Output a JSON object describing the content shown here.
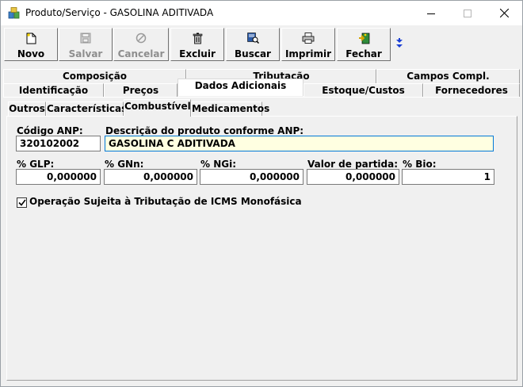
{
  "window": {
    "title": "Produto/Serviço - GASOLINA ADITIVADA",
    "icon": "app-products-icon",
    "controls": {
      "minimize": "minimize-icon",
      "maximize": "maximize-icon",
      "close": "close-icon"
    }
  },
  "toolbar": {
    "novo": "Novo",
    "salvar": "Salvar",
    "cancelar": "Cancelar",
    "excluir": "Excluir",
    "buscar": "Buscar",
    "imprimir": "Imprimir",
    "fechar": "Fechar"
  },
  "tabs_row1": [
    "Composição",
    "Tributação",
    "Campos Compl."
  ],
  "tabs_row2": [
    "Identificação",
    "Preços",
    "Dados Adicionais",
    "Estoque/Custos",
    "Fornecedores"
  ],
  "active_tab": "Dados Adicionais",
  "subtabs": [
    "Outros",
    "Características",
    "Combustível",
    "Medicamentos"
  ],
  "active_subtab": "Combustível",
  "form": {
    "codigo_anp_label": "Código ANP:",
    "codigo_anp_value": "320102002",
    "descricao_label": "Descrição do produto conforme ANP:",
    "descricao_value": "GASOLINA C ADITIVADA",
    "glp_label": "% GLP:",
    "glp_value": "0,000000",
    "gnn_label": "% GNn:",
    "gnn_value": "0,000000",
    "ngi_label": "% NGi:",
    "ngi_value": "0,000000",
    "valor_partida_label": "Valor de partida:",
    "valor_partida_value": "0,000000",
    "bio_label": "% Bio:",
    "bio_value": "1",
    "icms_mono_label": "Operação Sujeita à Tributação de ICMS Monofásica",
    "icms_mono_checked": true
  },
  "colors": {
    "accent": "#0078d7",
    "highlight_field": "#ffffe1",
    "disabled_text": "#8e8e8e"
  }
}
